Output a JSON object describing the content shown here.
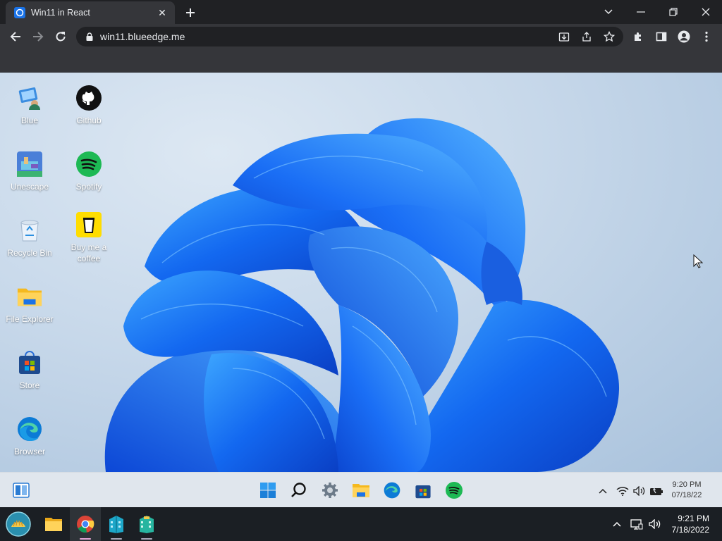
{
  "browser": {
    "tab_title": "Win11 in React",
    "url": "win11.blueedge.me"
  },
  "desktop": {
    "icons": [
      {
        "label": "Blue"
      },
      {
        "label": "Github"
      },
      {
        "label": "Unescape"
      },
      {
        "label": "Spotify"
      },
      {
        "label": "Recycle Bin"
      },
      {
        "label": "Buy me a coffee"
      },
      {
        "label": "File Explorer"
      },
      {
        "label": "Store"
      },
      {
        "label": "Browser"
      }
    ]
  },
  "win11_taskbar": {
    "apps": [
      "start-icon",
      "search-icon",
      "settings-icon",
      "file-explorer-icon",
      "edge-icon",
      "store-icon",
      "spotify-icon"
    ],
    "time": "9:20 PM",
    "date": "07/18/22"
  },
  "host_taskbar": {
    "time": "9:21 PM",
    "date": "7/18/2022",
    "colors": {
      "bar": "#1b1f24",
      "active_indicator": "#e6a8d7"
    }
  }
}
